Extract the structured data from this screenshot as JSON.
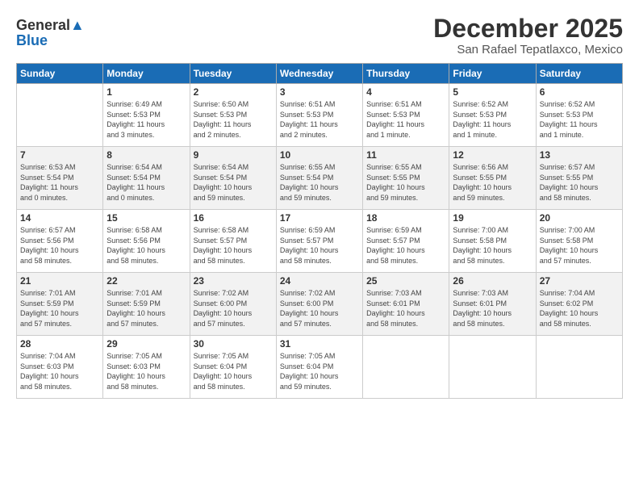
{
  "header": {
    "logo_line1": "General",
    "logo_line2": "Blue",
    "month": "December 2025",
    "location": "San Rafael Tepatlaxco, Mexico"
  },
  "weekdays": [
    "Sunday",
    "Monday",
    "Tuesday",
    "Wednesday",
    "Thursday",
    "Friday",
    "Saturday"
  ],
  "weeks": [
    [
      {
        "day": "",
        "info": ""
      },
      {
        "day": "1",
        "info": "Sunrise: 6:49 AM\nSunset: 5:53 PM\nDaylight: 11 hours\nand 3 minutes."
      },
      {
        "day": "2",
        "info": "Sunrise: 6:50 AM\nSunset: 5:53 PM\nDaylight: 11 hours\nand 2 minutes."
      },
      {
        "day": "3",
        "info": "Sunrise: 6:51 AM\nSunset: 5:53 PM\nDaylight: 11 hours\nand 2 minutes."
      },
      {
        "day": "4",
        "info": "Sunrise: 6:51 AM\nSunset: 5:53 PM\nDaylight: 11 hours\nand 1 minute."
      },
      {
        "day": "5",
        "info": "Sunrise: 6:52 AM\nSunset: 5:53 PM\nDaylight: 11 hours\nand 1 minute."
      },
      {
        "day": "6",
        "info": "Sunrise: 6:52 AM\nSunset: 5:53 PM\nDaylight: 11 hours\nand 1 minute."
      }
    ],
    [
      {
        "day": "7",
        "info": "Sunrise: 6:53 AM\nSunset: 5:54 PM\nDaylight: 11 hours\nand 0 minutes."
      },
      {
        "day": "8",
        "info": "Sunrise: 6:54 AM\nSunset: 5:54 PM\nDaylight: 11 hours\nand 0 minutes."
      },
      {
        "day": "9",
        "info": "Sunrise: 6:54 AM\nSunset: 5:54 PM\nDaylight: 10 hours\nand 59 minutes."
      },
      {
        "day": "10",
        "info": "Sunrise: 6:55 AM\nSunset: 5:54 PM\nDaylight: 10 hours\nand 59 minutes."
      },
      {
        "day": "11",
        "info": "Sunrise: 6:55 AM\nSunset: 5:55 PM\nDaylight: 10 hours\nand 59 minutes."
      },
      {
        "day": "12",
        "info": "Sunrise: 6:56 AM\nSunset: 5:55 PM\nDaylight: 10 hours\nand 59 minutes."
      },
      {
        "day": "13",
        "info": "Sunrise: 6:57 AM\nSunset: 5:55 PM\nDaylight: 10 hours\nand 58 minutes."
      }
    ],
    [
      {
        "day": "14",
        "info": "Sunrise: 6:57 AM\nSunset: 5:56 PM\nDaylight: 10 hours\nand 58 minutes."
      },
      {
        "day": "15",
        "info": "Sunrise: 6:58 AM\nSunset: 5:56 PM\nDaylight: 10 hours\nand 58 minutes."
      },
      {
        "day": "16",
        "info": "Sunrise: 6:58 AM\nSunset: 5:57 PM\nDaylight: 10 hours\nand 58 minutes."
      },
      {
        "day": "17",
        "info": "Sunrise: 6:59 AM\nSunset: 5:57 PM\nDaylight: 10 hours\nand 58 minutes."
      },
      {
        "day": "18",
        "info": "Sunrise: 6:59 AM\nSunset: 5:57 PM\nDaylight: 10 hours\nand 58 minutes."
      },
      {
        "day": "19",
        "info": "Sunrise: 7:00 AM\nSunset: 5:58 PM\nDaylight: 10 hours\nand 58 minutes."
      },
      {
        "day": "20",
        "info": "Sunrise: 7:00 AM\nSunset: 5:58 PM\nDaylight: 10 hours\nand 57 minutes."
      }
    ],
    [
      {
        "day": "21",
        "info": "Sunrise: 7:01 AM\nSunset: 5:59 PM\nDaylight: 10 hours\nand 57 minutes."
      },
      {
        "day": "22",
        "info": "Sunrise: 7:01 AM\nSunset: 5:59 PM\nDaylight: 10 hours\nand 57 minutes."
      },
      {
        "day": "23",
        "info": "Sunrise: 7:02 AM\nSunset: 6:00 PM\nDaylight: 10 hours\nand 57 minutes."
      },
      {
        "day": "24",
        "info": "Sunrise: 7:02 AM\nSunset: 6:00 PM\nDaylight: 10 hours\nand 57 minutes."
      },
      {
        "day": "25",
        "info": "Sunrise: 7:03 AM\nSunset: 6:01 PM\nDaylight: 10 hours\nand 58 minutes."
      },
      {
        "day": "26",
        "info": "Sunrise: 7:03 AM\nSunset: 6:01 PM\nDaylight: 10 hours\nand 58 minutes."
      },
      {
        "day": "27",
        "info": "Sunrise: 7:04 AM\nSunset: 6:02 PM\nDaylight: 10 hours\nand 58 minutes."
      }
    ],
    [
      {
        "day": "28",
        "info": "Sunrise: 7:04 AM\nSunset: 6:03 PM\nDaylight: 10 hours\nand 58 minutes."
      },
      {
        "day": "29",
        "info": "Sunrise: 7:05 AM\nSunset: 6:03 PM\nDaylight: 10 hours\nand 58 minutes."
      },
      {
        "day": "30",
        "info": "Sunrise: 7:05 AM\nSunset: 6:04 PM\nDaylight: 10 hours\nand 58 minutes."
      },
      {
        "day": "31",
        "info": "Sunrise: 7:05 AM\nSunset: 6:04 PM\nDaylight: 10 hours\nand 59 minutes."
      },
      {
        "day": "",
        "info": ""
      },
      {
        "day": "",
        "info": ""
      },
      {
        "day": "",
        "info": ""
      }
    ]
  ]
}
